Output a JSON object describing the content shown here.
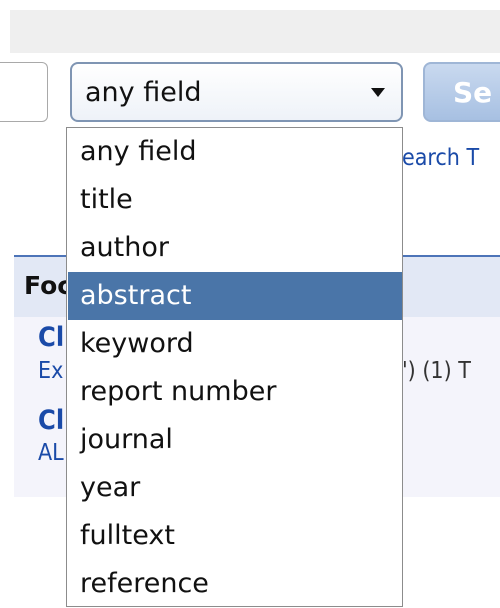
{
  "search": {
    "field_select_value": "any field",
    "button_label": "Se"
  },
  "background": {
    "hint": "earch T",
    "results_title": "Foc",
    "line1": "Cl",
    "line2": "Ex",
    "line3": "Cl",
    "line4": "AL",
    "line5": "') (1) T"
  },
  "dropdown": {
    "options": [
      "any field",
      "title",
      "author",
      "abstract",
      "keyword",
      "report number",
      "journal",
      "year",
      "fulltext",
      "reference"
    ],
    "highlighted": "abstract"
  },
  "colors": {
    "highlight": "#4a75a8",
    "link": "#1a4aa8"
  }
}
